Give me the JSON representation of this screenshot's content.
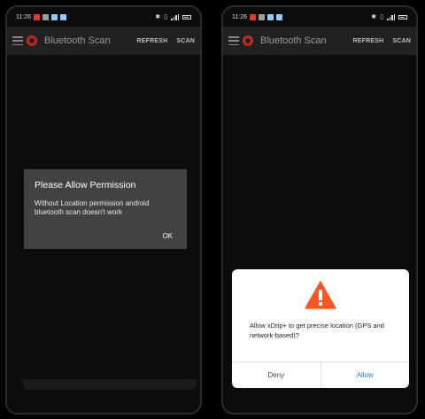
{
  "status_bar": {
    "time": "11:26"
  },
  "app_bar": {
    "title": "Bluetooth Scan",
    "refresh_label": "REFRESH",
    "scan_label": "SCAN"
  },
  "location_dialog": {
    "title": "Please Allow Permission",
    "message": "Without Location permission android bluetooth scan doesn't work",
    "ok_label": "OK"
  },
  "system_permission_dialog": {
    "message": "Allow xDrip+ to get precise location (GPS and network-based)?",
    "deny_label": "Deny",
    "allow_label": "Allow",
    "icon": "warning-icon"
  },
  "colors": {
    "app_bar_bg": "#212121",
    "dialog_dark_bg": "#424242",
    "warning_orange": "#ff5722",
    "allow_blue": "#1e88e5"
  }
}
